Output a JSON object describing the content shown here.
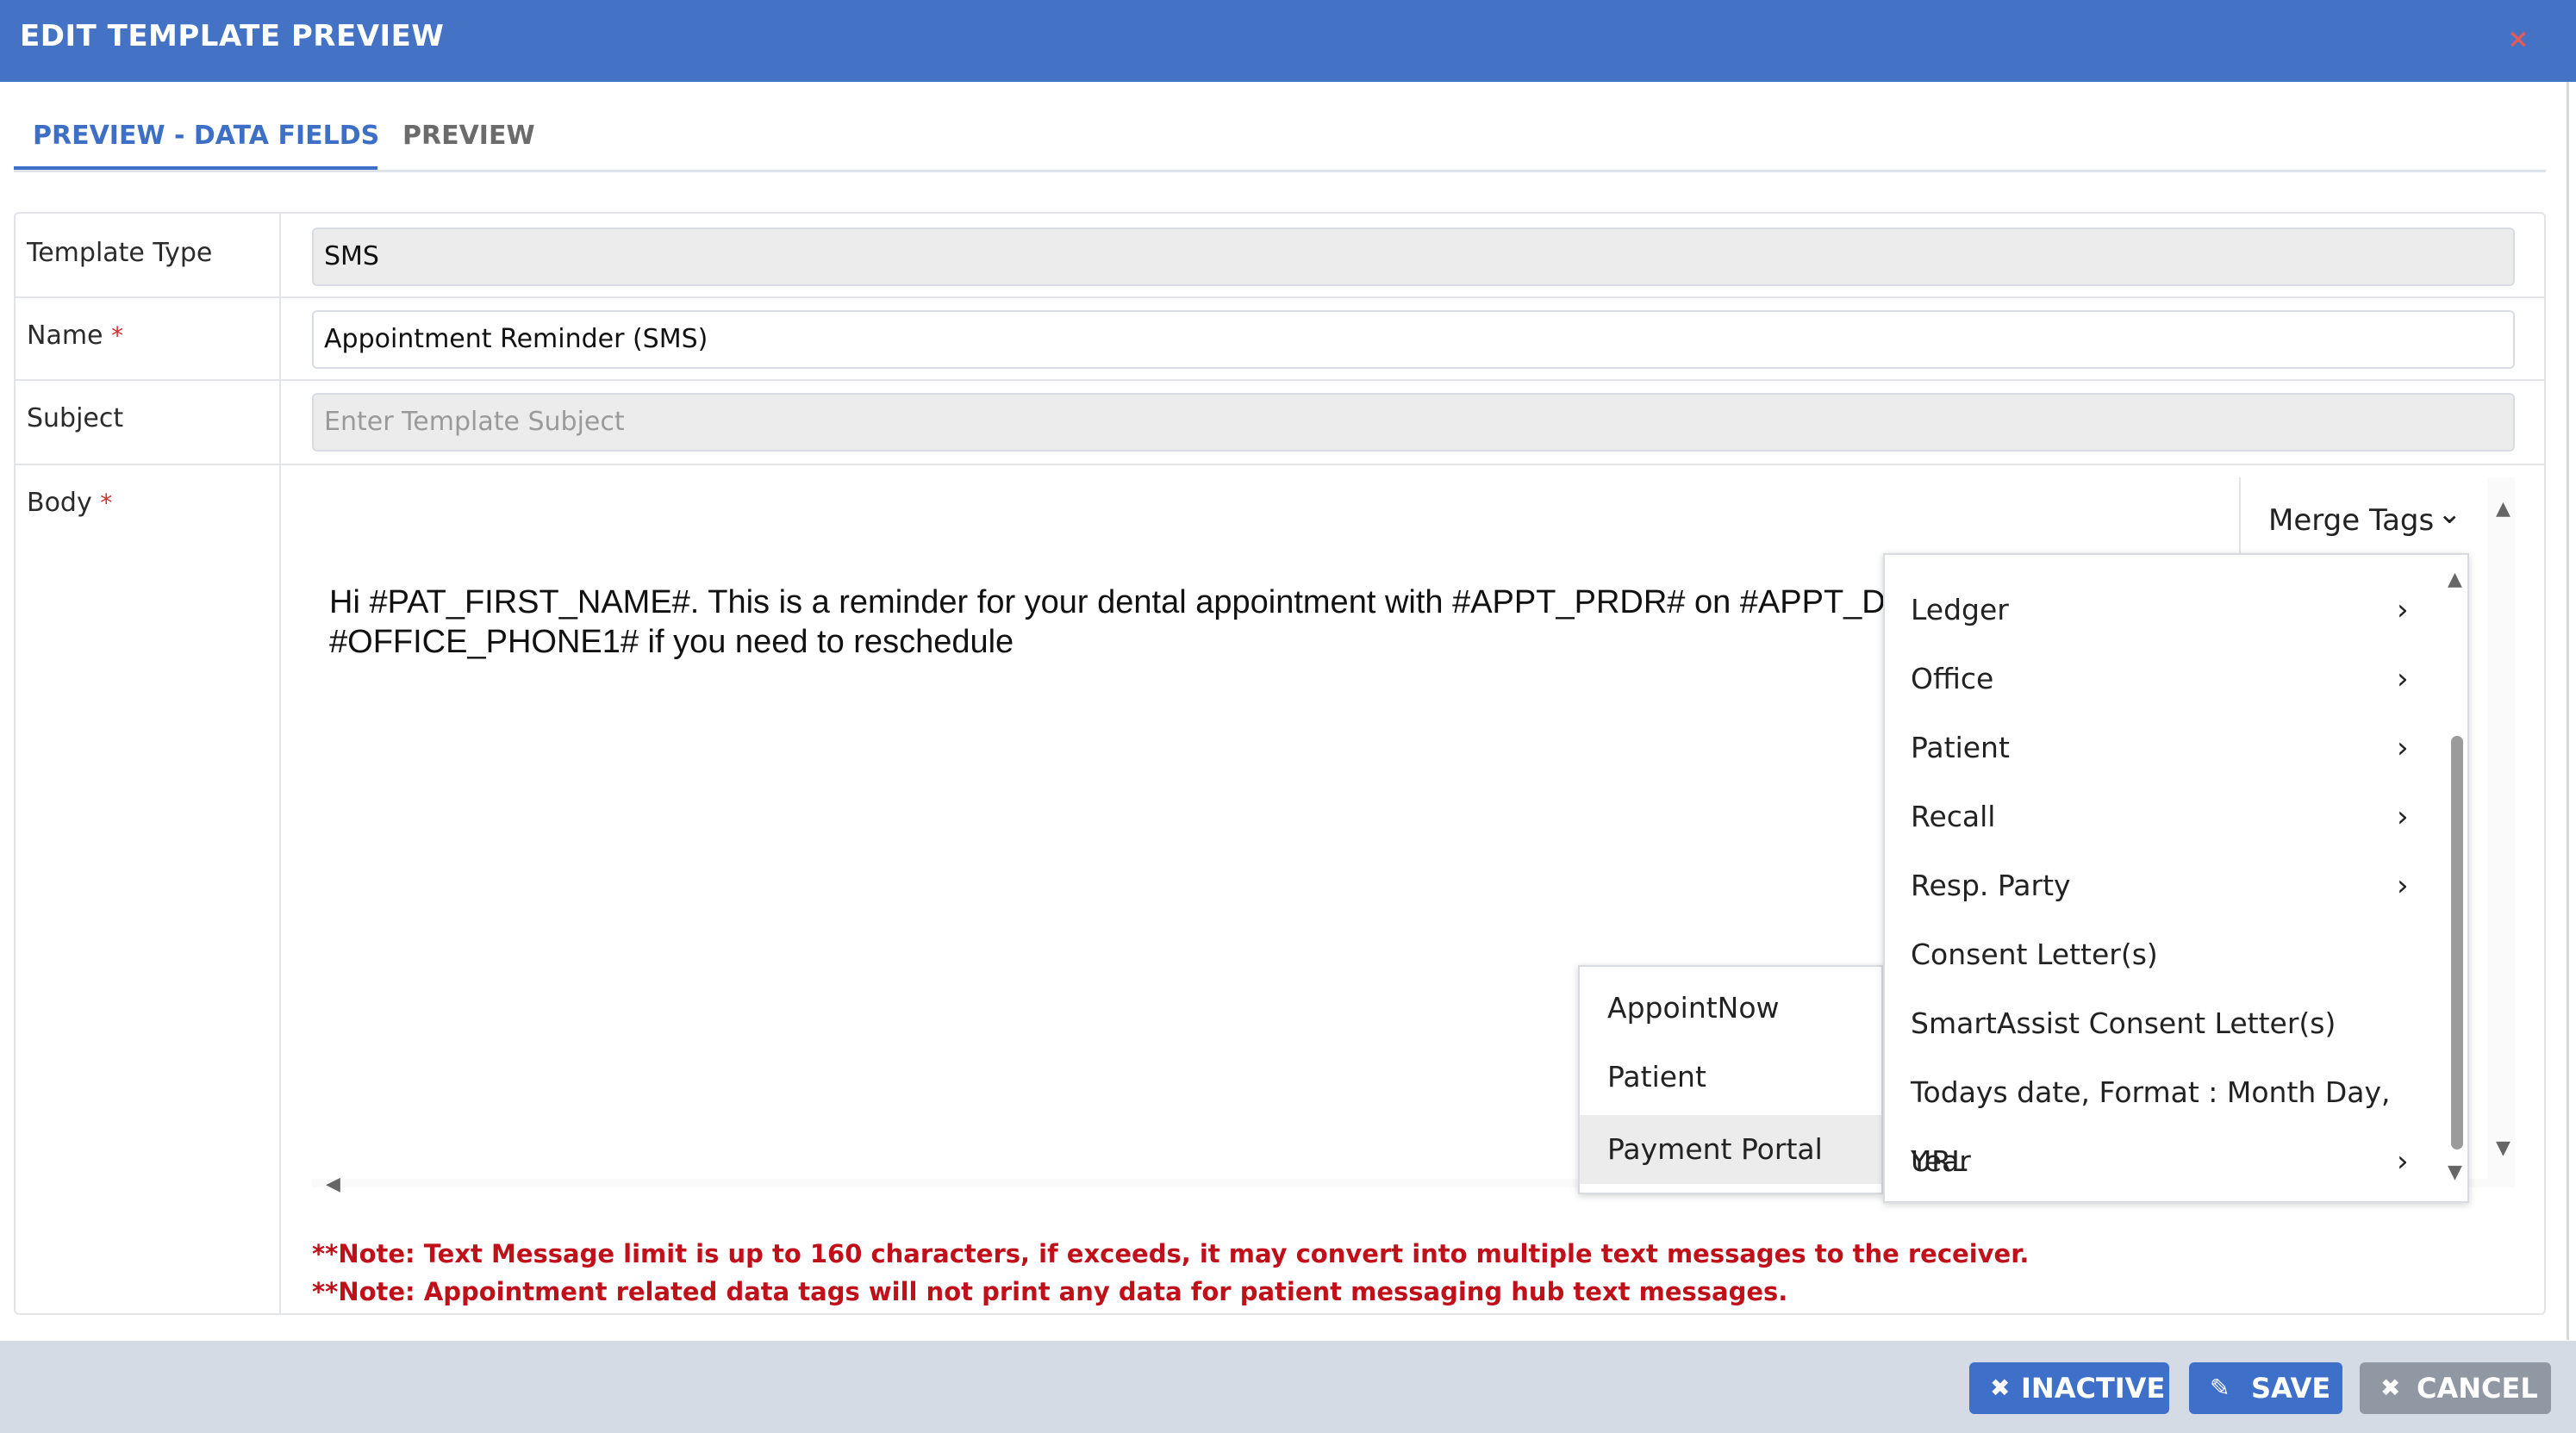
{
  "dialog": {
    "title": "EDIT TEMPLATE PREVIEW",
    "close_icon": "×"
  },
  "tabs": [
    {
      "label": "PREVIEW - DATA FIELDS",
      "active": true
    },
    {
      "label": "PREVIEW",
      "active": false
    }
  ],
  "form": {
    "template_type": {
      "label": "Template Type",
      "value": "SMS"
    },
    "name": {
      "label": "Name",
      "required_mark": "*",
      "value": "Appointment Reminder (SMS)"
    },
    "subject": {
      "label": "Subject",
      "placeholder": "Enter Template Subject",
      "value": ""
    },
    "body": {
      "label": "Body",
      "required_mark": "*",
      "line1": "Hi #PAT_FIRST_NAME#. This is a reminder for your dental appointment with #APPT_PRDR# on #APPT_DATE# at #APPT_TIME#. Please call",
      "line2": "#OFFICE_PHONE1# if you need to reschedule"
    }
  },
  "merge_tags": {
    "button_label": "Merge Tags",
    "menu_items": [
      {
        "label": "Ledger",
        "has_submenu": true
      },
      {
        "label": "Office",
        "has_submenu": true
      },
      {
        "label": "Patient",
        "has_submenu": true
      },
      {
        "label": "Recall",
        "has_submenu": true
      },
      {
        "label": "Resp. Party",
        "has_submenu": true
      },
      {
        "label": "Consent Letter(s)",
        "has_submenu": false
      },
      {
        "label": "SmartAssist Consent Letter(s)",
        "has_submenu": false
      },
      {
        "label": "Todays date, Format : Month Day, Year",
        "has_submenu": false
      },
      {
        "label": "URL",
        "has_submenu": true
      }
    ],
    "url_submenu": [
      {
        "label": "AppointNow"
      },
      {
        "label": "Patient Registration"
      },
      {
        "label": "Payment Portal",
        "highlighted": true
      }
    ]
  },
  "notes": [
    "**Note: Text Message limit is up to 160 characters, if exceeds, it may convert into multiple text messages to the receiver.",
    "**Note: Appointment related data tags will not print any data for patient messaging hub text messages."
  ],
  "footer": {
    "inactive_label": "INACTIVE",
    "save_label": "SAVE",
    "cancel_label": "CANCEL"
  },
  "colors": {
    "header_blue": "#4472c4",
    "accent_blue": "#3e6fc6",
    "required_red": "#d32f2f",
    "note_red": "#c0101a",
    "cancel_grey": "#8f98a3"
  }
}
